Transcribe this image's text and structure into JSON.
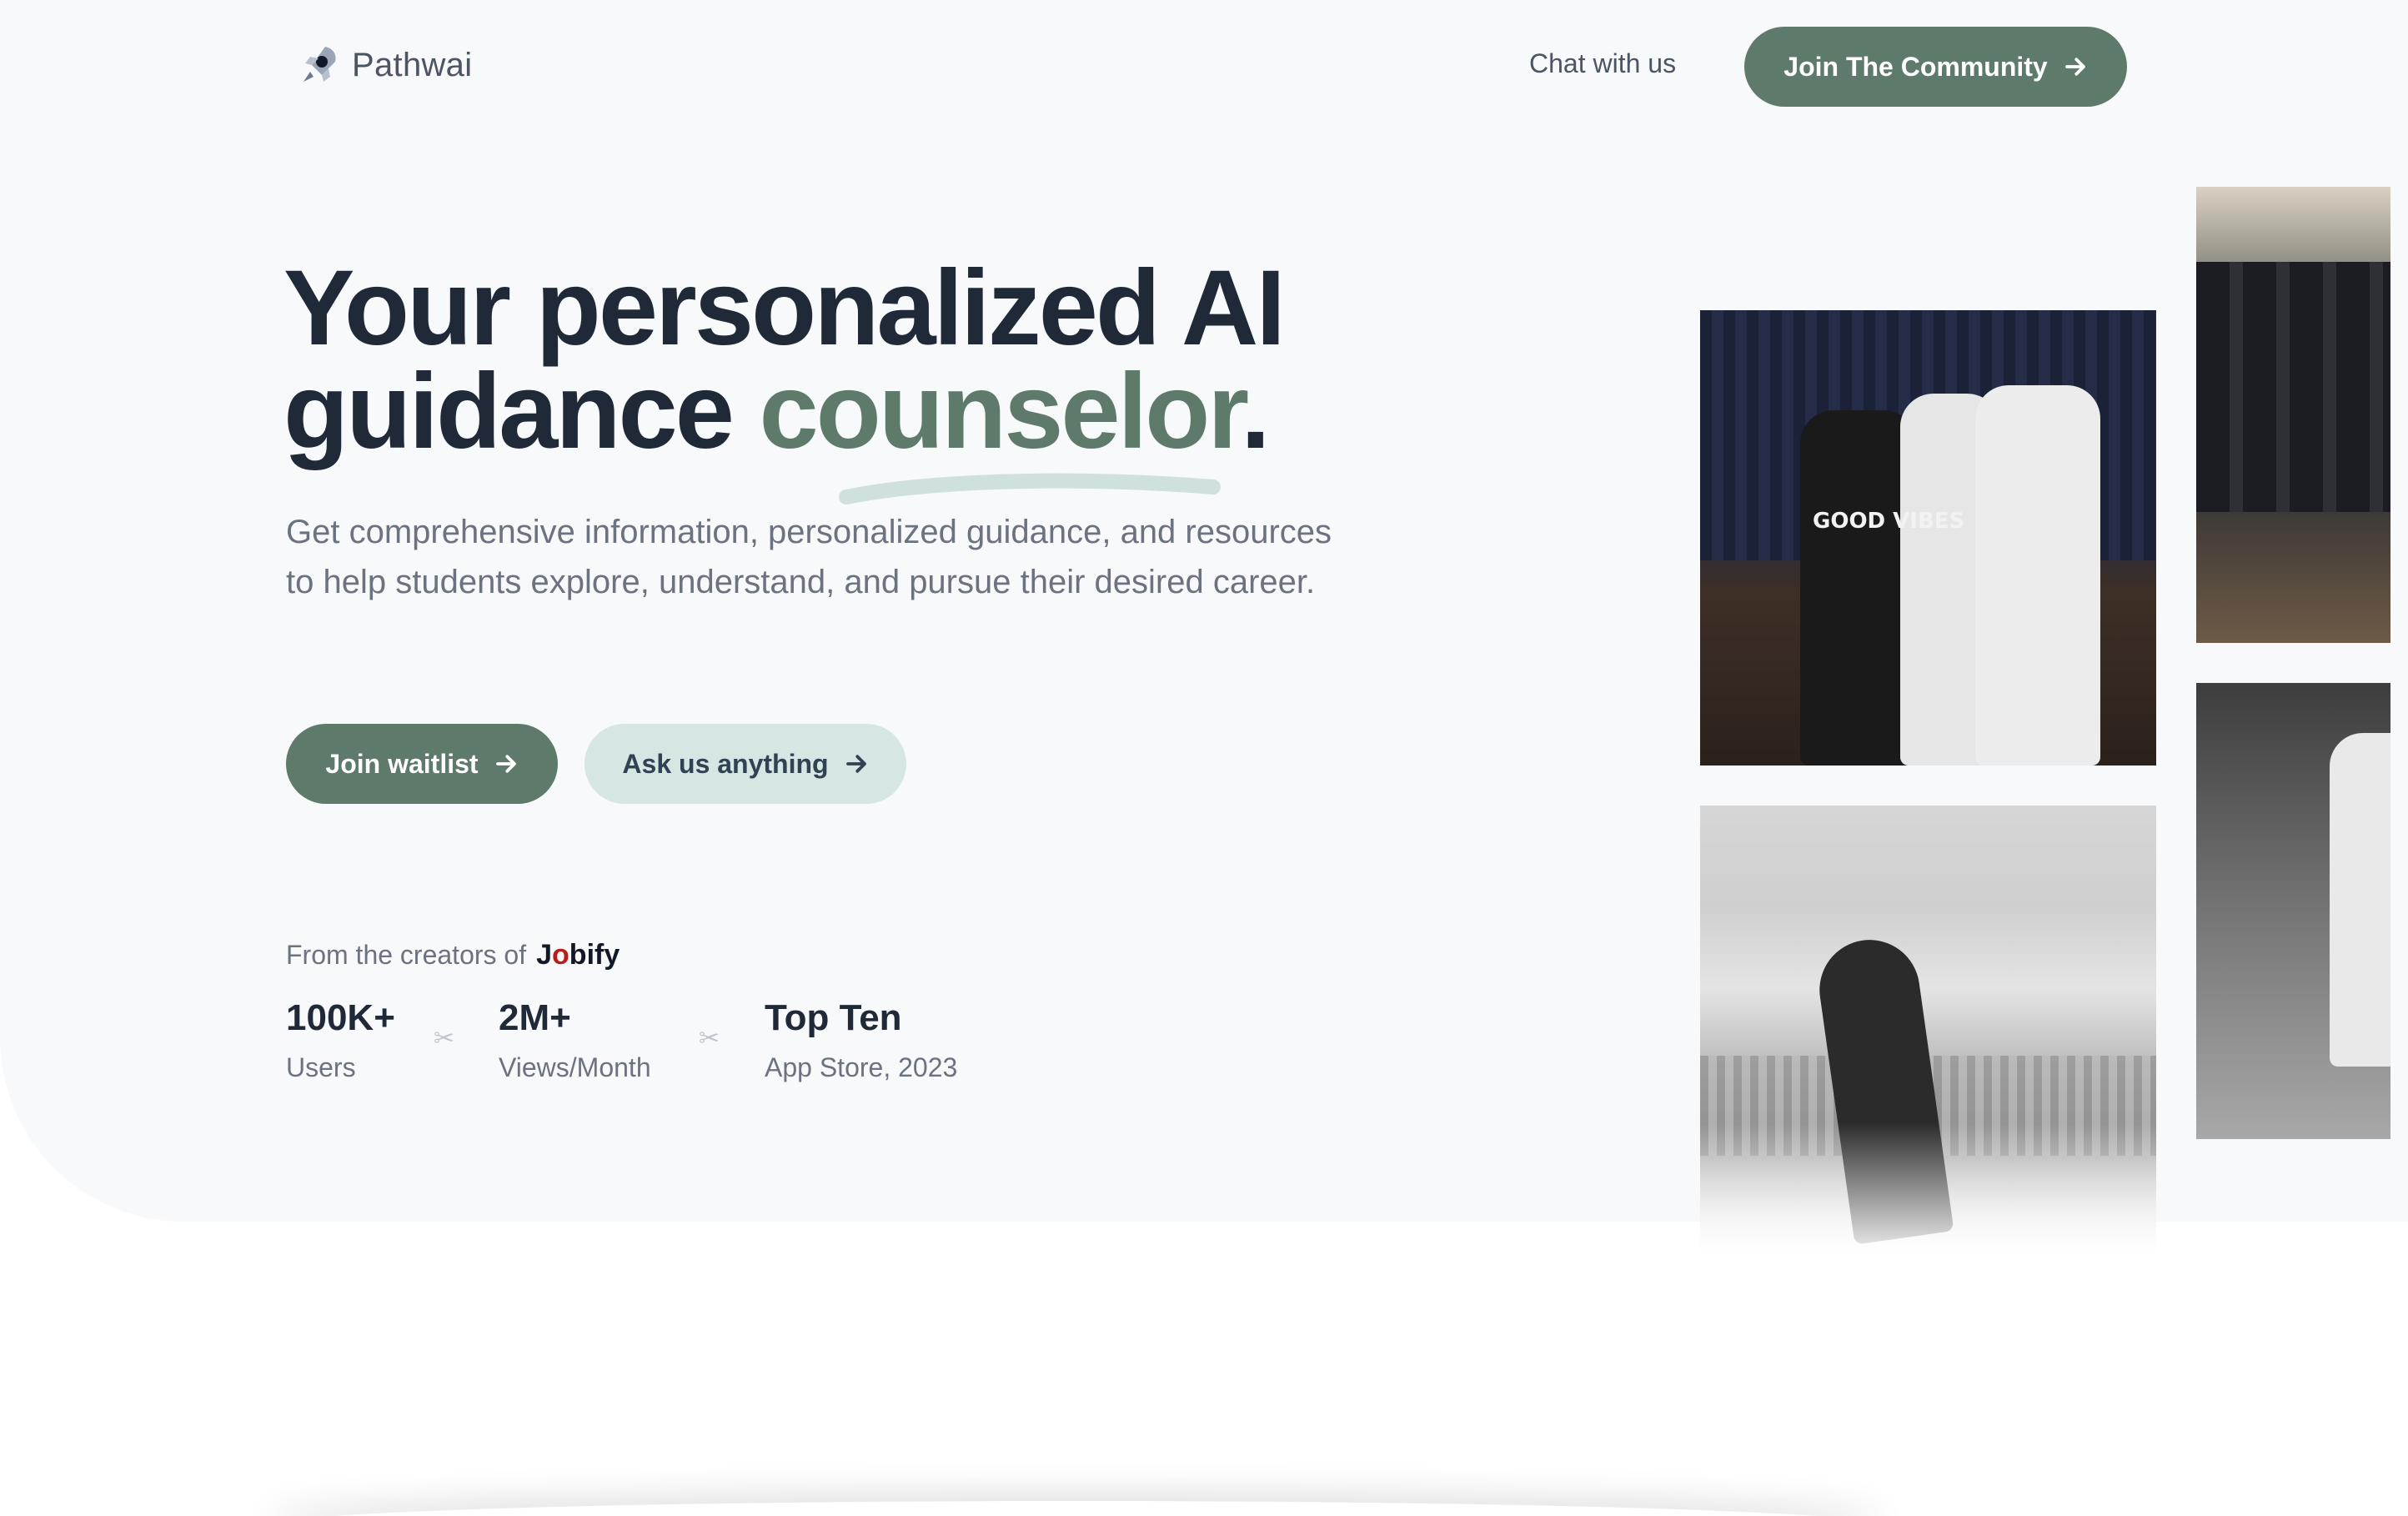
{
  "header": {
    "brand": "Pathwai",
    "chat_link": "Chat with us",
    "cta": "Join The Community"
  },
  "hero": {
    "headline_part1": "Your personalized AI guidance ",
    "headline_accent": "counselor",
    "headline_end": ".",
    "subtext": "Get comprehensive information, personalized guidance, and resources to help students explore, understand, and pursue their desired career.",
    "primary_button": "Join waitlist",
    "secondary_button": "Ask us anything"
  },
  "creators": {
    "prefix": "From the creators of",
    "brand_part1": "J",
    "brand_o": "o",
    "brand_part2": "bify"
  },
  "stats": [
    {
      "value": "100K+",
      "label": "Users"
    },
    {
      "value": "2M+",
      "label": "Views/Month"
    },
    {
      "value": "Top Ten",
      "label": "App Store, 2023"
    }
  ],
  "photos": {
    "shirt_text": "GOOD VIBES"
  },
  "colors": {
    "accent": "#5d7a6a",
    "accent_light": "#d6e6e2",
    "headline": "#1f2937",
    "muted": "#6b7280",
    "hero_bg": "#f8f9fb"
  },
  "icons": [
    "rocket-logo-icon",
    "arrow-right-icon"
  ]
}
